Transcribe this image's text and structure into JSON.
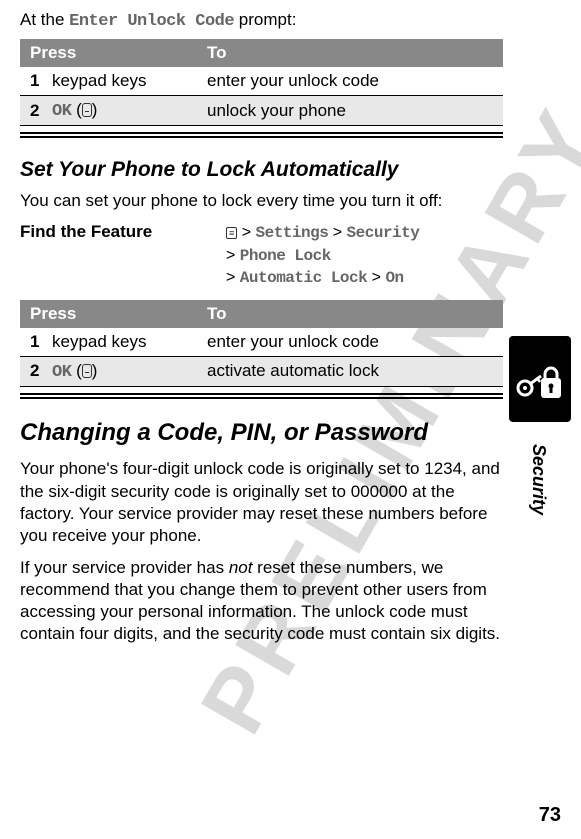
{
  "watermark": "PRELIMINARY",
  "intro": {
    "prefix": "At the ",
    "prompt": "Enter Unlock Code",
    "suffix": " prompt:"
  },
  "table_headers": {
    "press": "Press",
    "to": "To"
  },
  "table1": {
    "rows": [
      {
        "num": "1",
        "press": "keypad keys",
        "to": "enter your unlock code"
      },
      {
        "num": "2",
        "press_lcd": "OK",
        "press_suffix": " (",
        "press_suffix2": ")",
        "to": "unlock your phone"
      }
    ]
  },
  "subheading": "Set Your Phone to Lock Automatically",
  "sub_intro": "You can set your phone to lock every time you turn it off:",
  "feature_label": "Find the Feature",
  "feature_path": {
    "line1_mid": " > ",
    "settings": "Settings",
    "sep1": " > ",
    "security": "Security",
    "line2_prefix": "> ",
    "phone_lock": "Phone Lock",
    "line3_prefix": "> ",
    "auto_lock": "Automatic Lock",
    "sep3": " > ",
    "on": "On"
  },
  "table2": {
    "rows": [
      {
        "num": "1",
        "press": "keypad keys",
        "to": "enter your unlock code"
      },
      {
        "num": "2",
        "press_lcd": "OK",
        "press_suffix": " (",
        "press_suffix2": ")",
        "to": "activate automatic lock"
      }
    ]
  },
  "big_heading": "Changing a Code, PIN, or Password",
  "para1": "Your phone's four-digit unlock code is originally set to 1234, and the six-digit security code is originally set to 000000 at the factory. Your service provider may reset these numbers before you receive your phone.",
  "para2_prefix": "If your service provider has ",
  "para2_not": "not",
  "para2_suffix": " reset these numbers, we recommend that you change them to prevent other users from accessing your personal information. The unlock code must contain four digits, and the security code must contain six digits.",
  "side_label": "Security",
  "page_num": "73"
}
